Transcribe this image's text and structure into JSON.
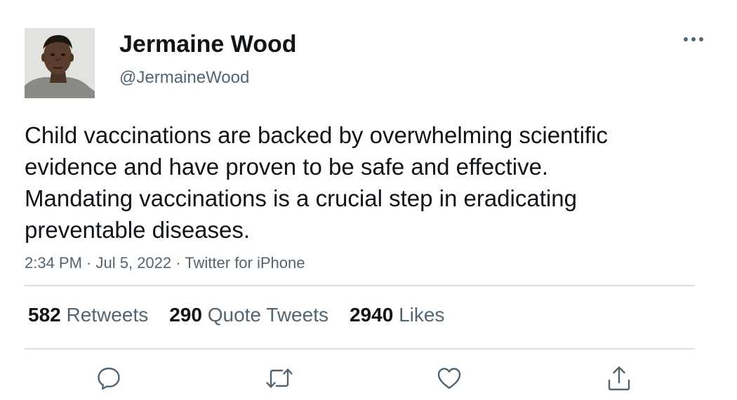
{
  "author": {
    "display_name": "Jermaine Wood",
    "handle": "@JermaineWood"
  },
  "tweet": {
    "text": "Child vaccinations are backed by overwhelming scientific evidence and have proven to be safe and effective. Mandating vaccinations is a crucial step in eradicating preventable diseases.",
    "time": "2:34 PM",
    "date": "Jul 5, 2022",
    "source": "Twitter for iPhone",
    "separator": " · "
  },
  "stats": {
    "retweets": {
      "count": "582",
      "label": "Retweets"
    },
    "quote_tweets": {
      "count": "290",
      "label": "Quote Tweets"
    },
    "likes": {
      "count": "2940",
      "label": "Likes"
    }
  },
  "actions": [
    {
      "name": "reply",
      "icon": "reply-icon"
    },
    {
      "name": "retweet",
      "icon": "retweet-icon"
    },
    {
      "name": "like",
      "icon": "heart-icon"
    },
    {
      "name": "share",
      "icon": "share-icon"
    }
  ],
  "colors": {
    "text": "#0f1419",
    "secondary": "#536471",
    "divider": "#d9dde0",
    "icon": "#536471"
  }
}
